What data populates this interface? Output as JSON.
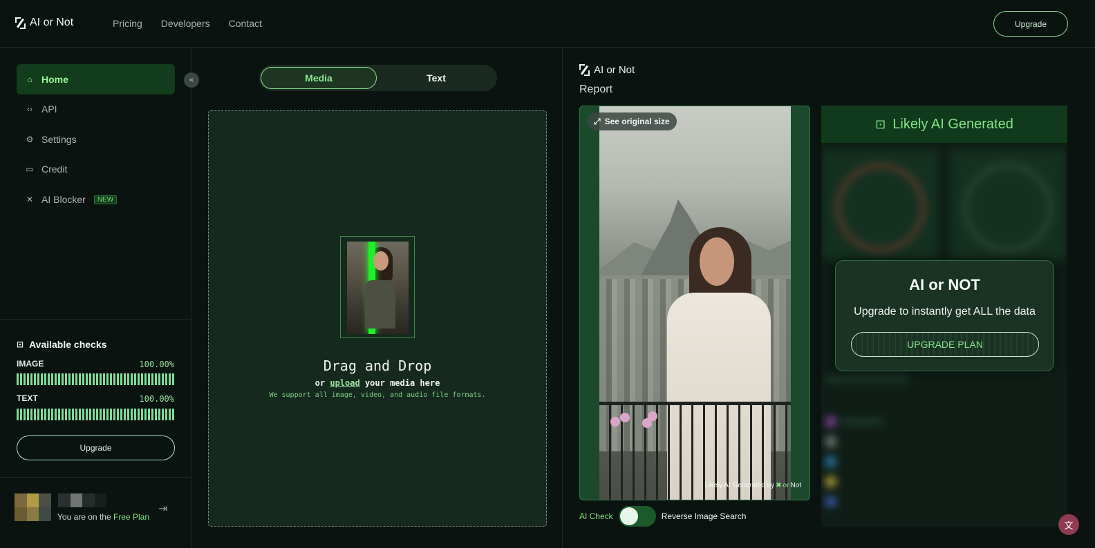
{
  "nav": {
    "logo_text": "AI or Not",
    "links": [
      "Pricing",
      "Developers",
      "Contact"
    ],
    "upgrade_label": "Upgrade"
  },
  "sidebar": {
    "items": [
      {
        "label": "Home",
        "icon": "home-icon",
        "active": true
      },
      {
        "label": "API",
        "icon": "code-icon"
      },
      {
        "label": "Settings",
        "icon": "gear-icon"
      },
      {
        "label": "Credit",
        "icon": "credit-icon"
      },
      {
        "label": "AI Blocker",
        "icon": "x-icon",
        "badge": "NEW"
      }
    ],
    "checks": {
      "title": "Available checks",
      "image_label": "IMAGE",
      "image_value": "100.00%",
      "text_label": "TEXT",
      "text_value": "100.00%"
    },
    "upgrade_label": "Upgrade",
    "plan_prefix": "You are on the",
    "plan_name": "Free Plan"
  },
  "middle": {
    "tabs": {
      "media": "Media",
      "text": "Text"
    },
    "drop_title": "Drag and Drop",
    "drop_or": "or",
    "drop_link": "upload",
    "drop_rest": "your media here",
    "drop_note": "We support all image, video, and audio file formats."
  },
  "report": {
    "logo_text": "AI or Not",
    "title": "Report",
    "see_original": "See original size",
    "watermark_prefix": "Likely AI Generated by",
    "watermark_brand_a": "or",
    "watermark_brand_b": "Not",
    "toggle_left": "AI Check",
    "toggle_right": "Reverse Image Search"
  },
  "result": {
    "verdict": "Likely AI Generated",
    "upsell_title": "AI or NOT",
    "upsell_text": "Upgrade to instantly get ALL the data",
    "upsell_button": "UPGRADE PLAN"
  },
  "colors": {
    "accent": "#86e48a",
    "background": "#0b1311",
    "panel": "#16291e"
  }
}
